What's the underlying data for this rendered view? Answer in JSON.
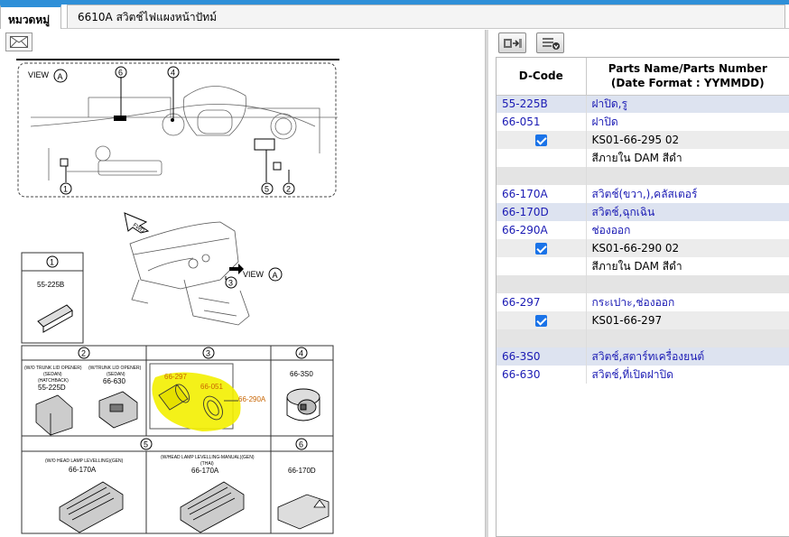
{
  "tabs": {
    "category_label": "หมวดหมู่",
    "title": "6610A  สวิตช์ไฟแผงหน้าปัทม์"
  },
  "diagram": {
    "view_label": "VIEW",
    "view_letter": "A",
    "arrow_label": "FWD",
    "callouts": [
      "1",
      "2",
      "3",
      "4",
      "5",
      "6"
    ],
    "panel1_code": "55-225B",
    "panel2_left_note_1": "(W/O TRUNK LID OPENER)",
    "panel2_left_note_2": "(SEDAN)",
    "panel2_left_note_3": "(HATCHBACK)",
    "panel2_left_code": "55-225D",
    "panel2_right_note_1": "(W/TRUNK LID OPENER)",
    "panel2_right_note_2": "(SEDAN)",
    "panel2_right_code": "66-630",
    "panel3_code_a": "66-297",
    "panel3_code_b": "66-051",
    "panel3_code_c": "66-290A",
    "panel4_code": "66-3S0",
    "panel5_left_note": "(W/O HEAD LAMP LEVELLING)(GEN)",
    "panel5_left_code": "66-170A",
    "panel5_right_note_1": "(W/HEAD LAMP LEVELLING-MANUAL)(GEN)",
    "panel5_right_note_2": "(THAI)",
    "panel5_right_code": "66-170A",
    "panel6_code": "66-170D"
  },
  "toolbar": {
    "icons": [
      "grid-export-icon",
      "list-download-icon"
    ]
  },
  "table": {
    "header_dcode": "D-Code",
    "header_name_1": "Parts Name/Parts Number",
    "header_name_2": "(Date Format : YYMMDD)",
    "rows": [
      {
        "type": "group",
        "code": "55-225B",
        "name": "ฝาปิด,รู"
      },
      {
        "type": "part",
        "code": "66-051",
        "name": "ฝาปิด"
      },
      {
        "type": "num",
        "checked": true,
        "name": "KS01-66-295 02"
      },
      {
        "type": "note",
        "name": "สีภายใน DAM สีดำ"
      },
      {
        "type": "spacer"
      },
      {
        "type": "part",
        "code": "66-170A",
        "name": "สวิตช์(ขวา,),คลัสเตอร์"
      },
      {
        "type": "group",
        "code": "66-170D",
        "name": "สวิตช์,ฉุกเฉิน"
      },
      {
        "type": "part",
        "code": "66-290A",
        "name": "ช่องออก"
      },
      {
        "type": "num",
        "checked": true,
        "name": "KS01-66-290 02"
      },
      {
        "type": "note",
        "name": "สีภายใน DAM สีดำ"
      },
      {
        "type": "spacer"
      },
      {
        "type": "part",
        "code": "66-297",
        "name": "กระเปาะ,ช่องออก"
      },
      {
        "type": "num",
        "checked": true,
        "name": "KS01-66-297"
      },
      {
        "type": "spacer"
      },
      {
        "type": "group",
        "code": "66-3S0",
        "name": "สวิตช์,สตาร์ทเครื่องยนต์"
      },
      {
        "type": "part",
        "code": "66-630",
        "name": "สวิตช์,ที่เปิดฝาปิด"
      }
    ]
  }
}
